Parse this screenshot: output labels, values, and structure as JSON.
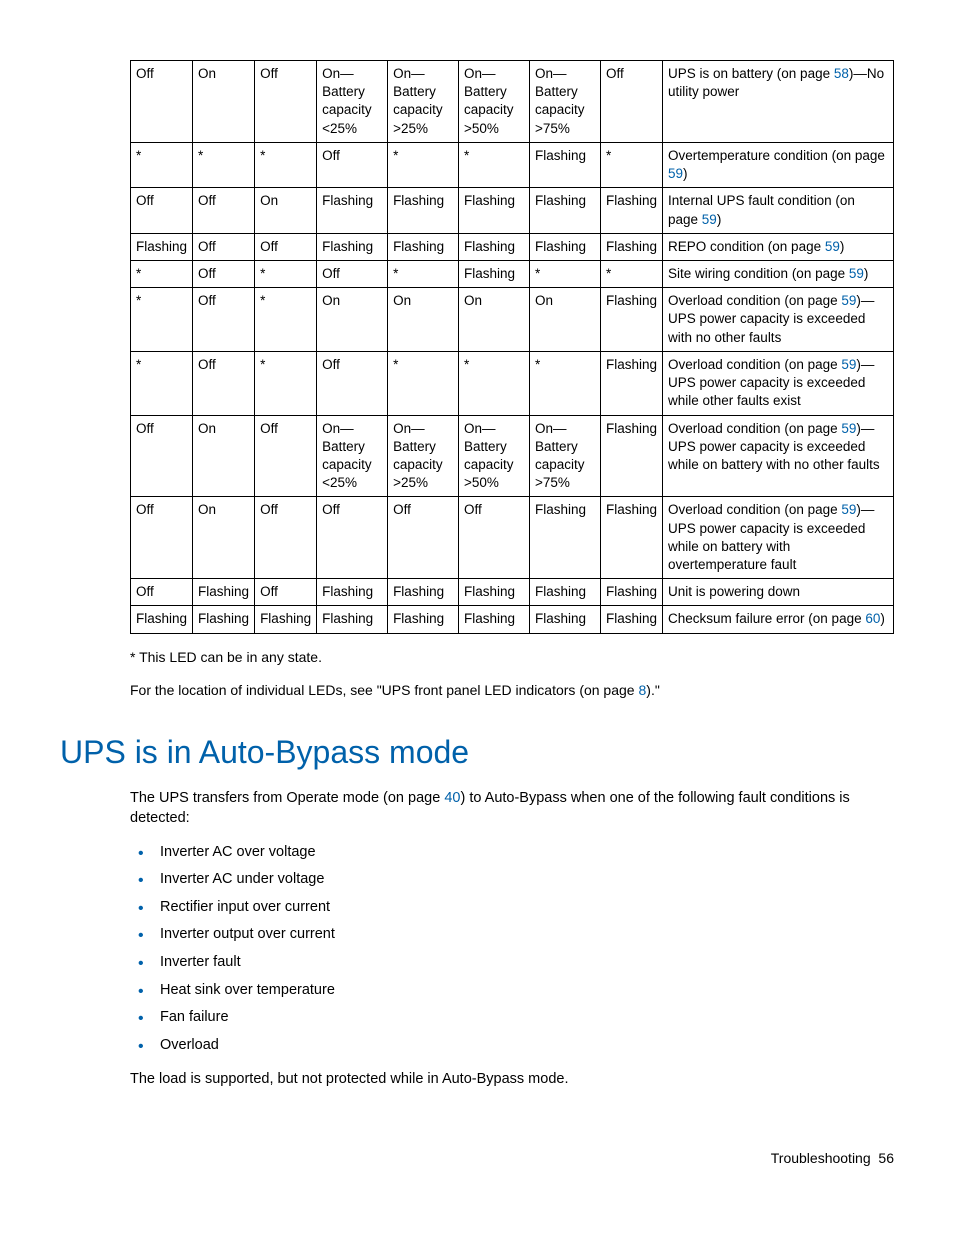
{
  "table": {
    "rows": [
      {
        "cols": [
          "Off",
          "On",
          "Off",
          "On—Battery capacity <25%",
          "On—Battery capacity >25%",
          "On—Battery capacity >50%",
          "On—Battery capacity >75%",
          "Off"
        ],
        "desc_pre": "UPS is on battery (on page ",
        "desc_link": "58",
        "desc_post": ")—No utility power"
      },
      {
        "cols": [
          "*",
          "*",
          "*",
          "Off",
          "*",
          "*",
          "Flashing",
          "*"
        ],
        "desc_pre": "Overtemperature condition (on page ",
        "desc_link": "59",
        "desc_post": ")"
      },
      {
        "cols": [
          "Off",
          "Off",
          "On",
          "Flashing",
          "Flashing",
          "Flashing",
          "Flashing",
          "Flashing"
        ],
        "desc_pre": "Internal UPS fault condition (on page ",
        "desc_link": "59",
        "desc_post": ")"
      },
      {
        "cols": [
          "Flashing",
          "Off",
          "Off",
          "Flashing",
          "Flashing",
          "Flashing",
          "Flashing",
          "Flashing"
        ],
        "desc_pre": "REPO condition (on page ",
        "desc_link": "59",
        "desc_post": ")"
      },
      {
        "cols": [
          "*",
          "Off",
          "*",
          "Off",
          "*",
          "Flashing",
          "*",
          "*"
        ],
        "desc_pre": "Site wiring condition (on page ",
        "desc_link": "59",
        "desc_post": ")"
      },
      {
        "cols": [
          "*",
          "Off",
          "*",
          "On",
          "On",
          "On",
          "On",
          "Flashing"
        ],
        "desc_pre": "Overload condition (on page ",
        "desc_link": "59",
        "desc_post": ")—UPS power capacity is exceeded with no other faults"
      },
      {
        "cols": [
          "*",
          "Off",
          "*",
          "Off",
          "*",
          "*",
          "*",
          "Flashing"
        ],
        "desc_pre": "Overload condition (on page ",
        "desc_link": "59",
        "desc_post": ")—UPS power capacity is exceeded while other faults exist"
      },
      {
        "cols": [
          "Off",
          "On",
          "Off",
          "On—Battery capacity <25%",
          "On—Battery capacity >25%",
          "On—Battery capacity >50%",
          "On—Battery capacity >75%",
          "Flashing"
        ],
        "desc_pre": "Overload condition (on page ",
        "desc_link": "59",
        "desc_post": ")—UPS power capacity is exceeded while on battery with no other faults"
      },
      {
        "cols": [
          "Off",
          "On",
          "Off",
          "Off",
          "Off",
          "Off",
          "Flashing",
          "Flashing"
        ],
        "desc_pre": "Overload condition (on page ",
        "desc_link": "59",
        "desc_post": ")—UPS power capacity is exceeded while on battery with overtemperature fault"
      },
      {
        "cols": [
          "Off",
          "Flashing",
          "Off",
          "Flashing",
          "Flashing",
          "Flashing",
          "Flashing",
          "Flashing"
        ],
        "desc_pre": "Unit is powering down",
        "desc_link": "",
        "desc_post": ""
      },
      {
        "cols": [
          "Flashing",
          "Flashing",
          "Flashing",
          "Flashing",
          "Flashing",
          "Flashing",
          "Flashing",
          "Flashing"
        ],
        "desc_pre": "Checksum failure error (on page ",
        "desc_link": "60",
        "desc_post": ")"
      }
    ]
  },
  "note": "* This LED can be in any state.",
  "ref_pre": "For the location of individual LEDs, see \"UPS front panel LED indicators (on page ",
  "ref_link": "8",
  "ref_post": ").\"",
  "heading": "UPS is in Auto-Bypass mode",
  "intro_pre": "The UPS transfers from Operate mode (on page ",
  "intro_link": "40",
  "intro_post": ") to Auto-Bypass when one of the following fault conditions is detected:",
  "bullets": [
    "Inverter AC over voltage",
    "Inverter AC under voltage",
    "Rectifier input over current",
    "Inverter output over current",
    "Inverter fault",
    "Heat sink over temperature",
    "Fan failure",
    "Overload"
  ],
  "closing": "The load is supported, but not protected while in Auto-Bypass mode.",
  "footer_section": "Troubleshooting",
  "footer_page": "56"
}
